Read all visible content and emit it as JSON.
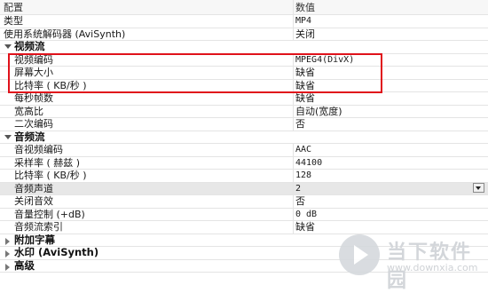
{
  "header": {
    "name_col": "配置",
    "value_col": "数值"
  },
  "rows_top": [
    {
      "label": "类型",
      "value": "MP4"
    },
    {
      "label": "使用系统解码器 (AviSynth)",
      "value": "关闭"
    }
  ],
  "video": {
    "title": "视频流",
    "rows": [
      {
        "label": "视频编码",
        "value": "MPEG4(DivX)"
      },
      {
        "label": "屏幕大小",
        "value": "缺省"
      },
      {
        "label": "比特率 ( KB/秒 )",
        "value": "缺省"
      },
      {
        "label": "每秒帧数",
        "value": "缺省"
      },
      {
        "label": "宽高比",
        "value": "自动(宽度)"
      },
      {
        "label": "二次编码",
        "value": "否"
      }
    ]
  },
  "audio": {
    "title": "音频流",
    "rows": [
      {
        "label": "音视频编码",
        "value": "AAC"
      },
      {
        "label": "采样率 ( 赫兹 )",
        "value": "44100"
      },
      {
        "label": "比特率 ( KB/秒 )",
        "value": "128"
      },
      {
        "label": "音频声道",
        "value": "2"
      },
      {
        "label": "关闭音效",
        "value": "否"
      },
      {
        "label": "音量控制 (+dB)",
        "value": "0 dB"
      },
      {
        "label": "音频流索引",
        "value": "缺省"
      }
    ]
  },
  "collapsed": [
    {
      "label": "附加字幕"
    },
    {
      "label": "水印 (AviSynth)"
    },
    {
      "label": "高级"
    }
  ],
  "watermark": {
    "title": "当下软件园",
    "url": "www.downxia.com"
  },
  "colors": {
    "highlight_border": "#e0121b",
    "selected_row": "#e7e7e7"
  }
}
